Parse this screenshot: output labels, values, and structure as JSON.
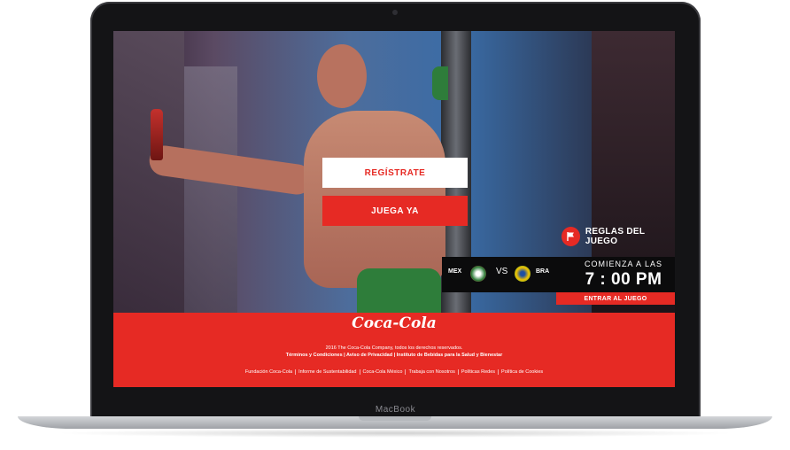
{
  "device": {
    "label": "MacBook"
  },
  "hero": {
    "register_label": "REGÍSTRATE",
    "play_label": "JUEGA YA",
    "rules_label": "REGLAS DEL JUEGO"
  },
  "match": {
    "team_home": "MEX",
    "vs": "VS",
    "team_away": "BRA",
    "starts_label": "COMIENZA A LAS",
    "time": "7 : 00 PM",
    "enter_label": "ENTRAR AL JUEGO"
  },
  "footer": {
    "logo_text": "Coca-Cola",
    "copyright": "2016 The Coca-Cola Company, todos los derechos reservados.",
    "legal_links": [
      "Términos y Condiciones",
      "Aviso de Privacidad",
      "Instituto de Bebidas para la Salud y Bienestar"
    ],
    "links": [
      "Fundación Coca-Cola",
      "Informe de Sustentabilidad",
      "Coca-Cola México",
      "Trabaja con Nosotros",
      "Políticas Redes",
      "Política de Cookies"
    ]
  },
  "colors": {
    "brand_red": "#e62a24",
    "mex_green": "#2e7d3a",
    "bra_yellow": "#f2c200"
  }
}
